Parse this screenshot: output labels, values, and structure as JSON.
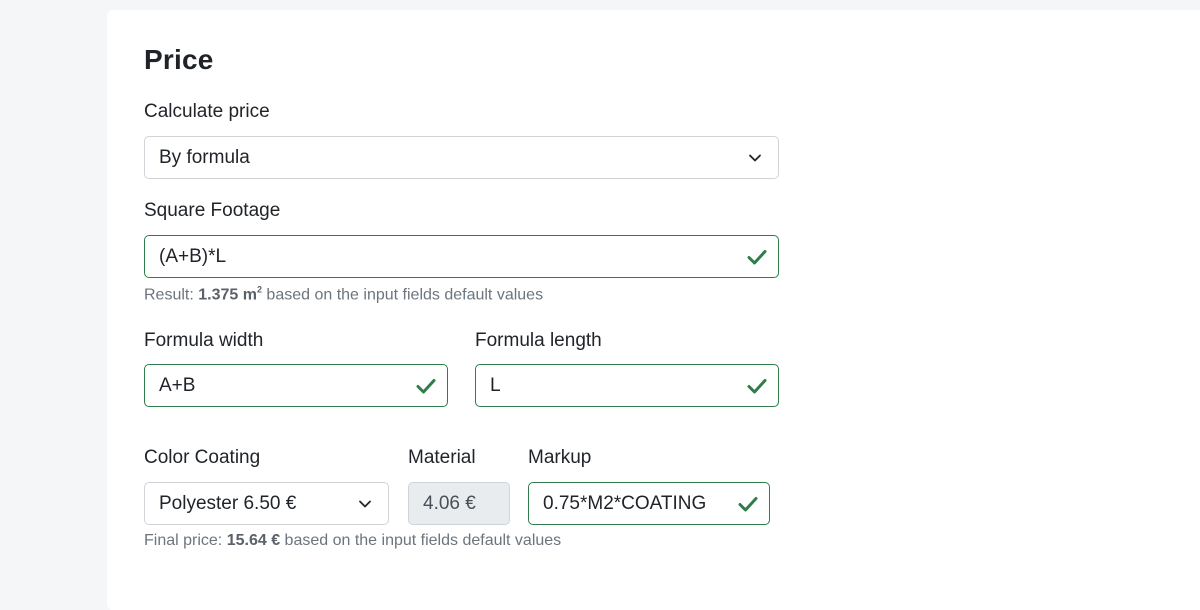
{
  "section": {
    "title": "Price"
  },
  "calculate_price": {
    "label": "Calculate price",
    "selected": "By formula"
  },
  "square_footage": {
    "label": "Square Footage",
    "value": "(A+B)*L",
    "help_prefix": "Result: ",
    "help_value": "1.375 m",
    "help_unit_sup": "2",
    "help_suffix": " based on the input fields default values"
  },
  "formula_width": {
    "label": "Formula width",
    "value": "A+B"
  },
  "formula_length": {
    "label": "Formula length",
    "value": "L"
  },
  "color_coating": {
    "label": "Color Coating",
    "selected": "Polyester 6.50 €"
  },
  "material": {
    "label": "Material",
    "value": "4.06 €"
  },
  "markup": {
    "label": "Markup",
    "value": "0.75*M2*COATING"
  },
  "final_price": {
    "prefix": "Final price: ",
    "value": "15.64 €",
    "suffix": " based on the input fields default values"
  },
  "colors": {
    "valid": "#2f7d4a",
    "border": "#d0d4d9",
    "disabled_bg": "#e9ecef"
  }
}
